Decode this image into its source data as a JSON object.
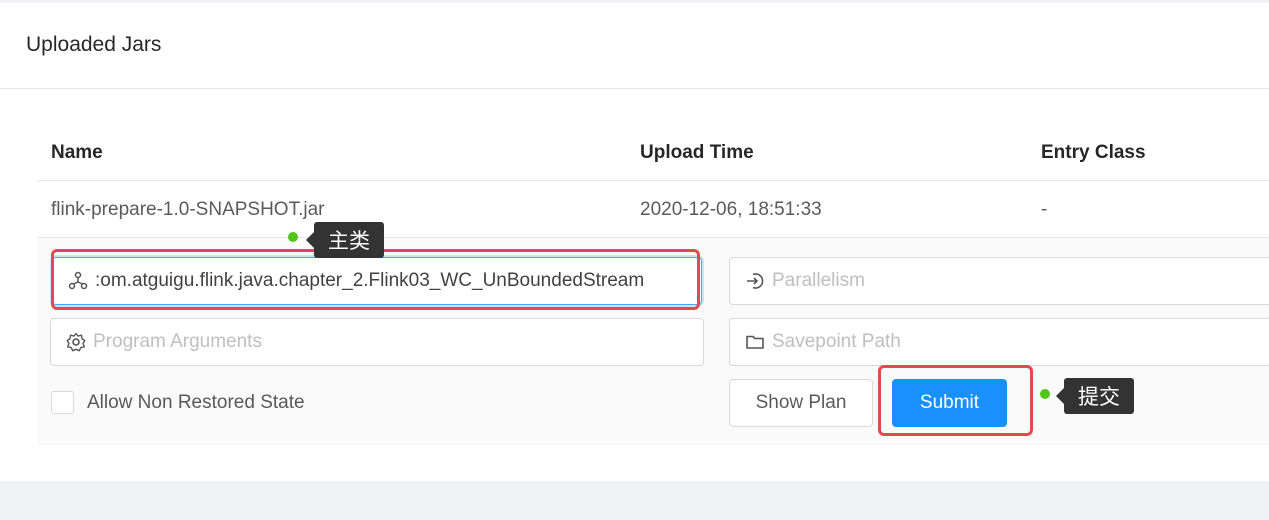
{
  "card": {
    "title": "Uploaded Jars"
  },
  "table": {
    "columns": [
      "Name",
      "Upload Time",
      "Entry Class"
    ],
    "rows": [
      {
        "name": "flink-prepare-1.0-SNAPSHOT.jar",
        "upload_time": "2020-12-06, 18:51:33",
        "entry_class": "-"
      }
    ]
  },
  "form": {
    "entry_class_value": ":om.atguigu.flink.java.chapter_2.Flink03_WC_UnBoundedStream",
    "parallelism_placeholder": "Parallelism",
    "program_args_placeholder": "Program Arguments",
    "savepoint_placeholder": "Savepoint Path",
    "allow_non_restored_label": "Allow Non Restored State",
    "show_plan_label": "Show Plan",
    "submit_label": "Submit"
  },
  "annotations": {
    "main_class_tip": "主类",
    "submit_tip": "提交"
  },
  "colors": {
    "primary": "#1890ff",
    "highlight": "#e04b4b",
    "marker": "#52c41a"
  },
  "icons": [
    "cluster-icon",
    "login-icon",
    "setting-icon",
    "folder-icon"
  ]
}
